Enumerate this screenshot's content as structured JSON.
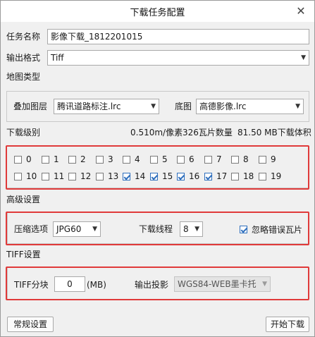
{
  "window": {
    "title": "下载任务配置",
    "close_glyph": "✕"
  },
  "task": {
    "label": "任务名称",
    "value": "影像下载_1812201015"
  },
  "output_format": {
    "label": "输出格式",
    "value": "Tiff"
  },
  "map_type": {
    "section_title": "地图类型",
    "overlay_label": "叠加图层",
    "overlay_value": "腾讯道路标注.lrc",
    "base_label": "底图",
    "base_value": "高德影像.lrc"
  },
  "levels": {
    "section_title": "下载级别",
    "resolution": "0.510m/像素",
    "tile_count": "326瓦片数量",
    "size": "81.50 MB下载体积",
    "items": [
      {
        "label": "0",
        "checked": false
      },
      {
        "label": "1",
        "checked": false
      },
      {
        "label": "2",
        "checked": false
      },
      {
        "label": "3",
        "checked": false
      },
      {
        "label": "4",
        "checked": false
      },
      {
        "label": "5",
        "checked": false
      },
      {
        "label": "6",
        "checked": false
      },
      {
        "label": "7",
        "checked": false
      },
      {
        "label": "8",
        "checked": false
      },
      {
        "label": "9",
        "checked": false
      },
      {
        "label": "10",
        "checked": false
      },
      {
        "label": "11",
        "checked": false
      },
      {
        "label": "12",
        "checked": false
      },
      {
        "label": "13",
        "checked": false
      },
      {
        "label": "14",
        "checked": true
      },
      {
        "label": "15",
        "checked": true
      },
      {
        "label": "16",
        "checked": true
      },
      {
        "label": "17",
        "checked": true
      },
      {
        "label": "18",
        "checked": false
      },
      {
        "label": "19",
        "checked": false
      }
    ]
  },
  "advanced": {
    "section_title": "高级设置",
    "compress_label": "压缩选项",
    "compress_value": "JPG60",
    "threads_label": "下载线程",
    "threads_value": "8",
    "ignore_errors_label": "忽略错误瓦片",
    "ignore_errors_checked": true
  },
  "tiff": {
    "section_title": "TIFF设置",
    "split_label": "TIFF分块",
    "split_value": "0",
    "split_unit": "(MB)",
    "projection_label": "输出投影",
    "projection_value": "WGS84-WEB墨卡托"
  },
  "footer": {
    "general_settings": "常规设置",
    "start_download": "开始下载"
  },
  "colors": {
    "highlight_border": "#e03a3a",
    "check_accent": "#2f6fbd"
  }
}
